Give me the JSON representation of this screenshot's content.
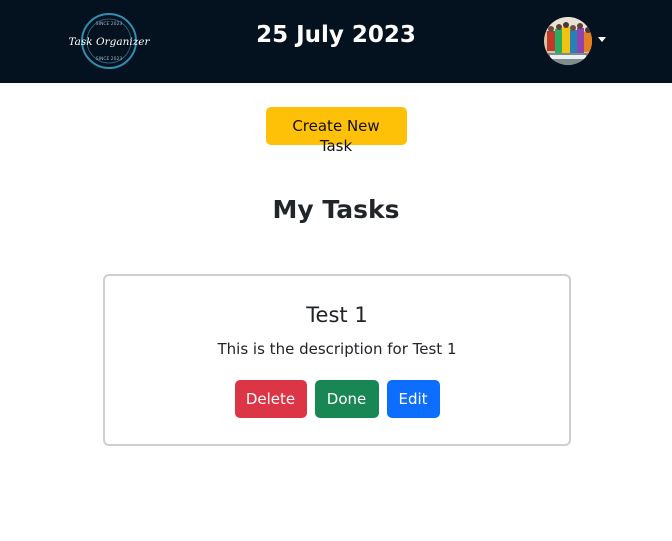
{
  "header": {
    "logo_text": "Task Organizer",
    "logo_ring_text": "SINCE 2023",
    "date": "25 July 2023",
    "avatar_icon": "user-avatar",
    "dropdown_icon": "caret-down-icon",
    "background_color": "#04111f"
  },
  "actions": {
    "create_label": "Create New Task"
  },
  "main": {
    "title": "My Tasks",
    "tasks": [
      {
        "title": "Test 1",
        "description": "This is the description for Test 1",
        "delete_label": "Delete",
        "done_label": "Done",
        "edit_label": "Edit"
      }
    ]
  },
  "colors": {
    "create": "#ffc107",
    "delete": "#dc3545",
    "done": "#198754",
    "edit": "#0d6efd"
  }
}
